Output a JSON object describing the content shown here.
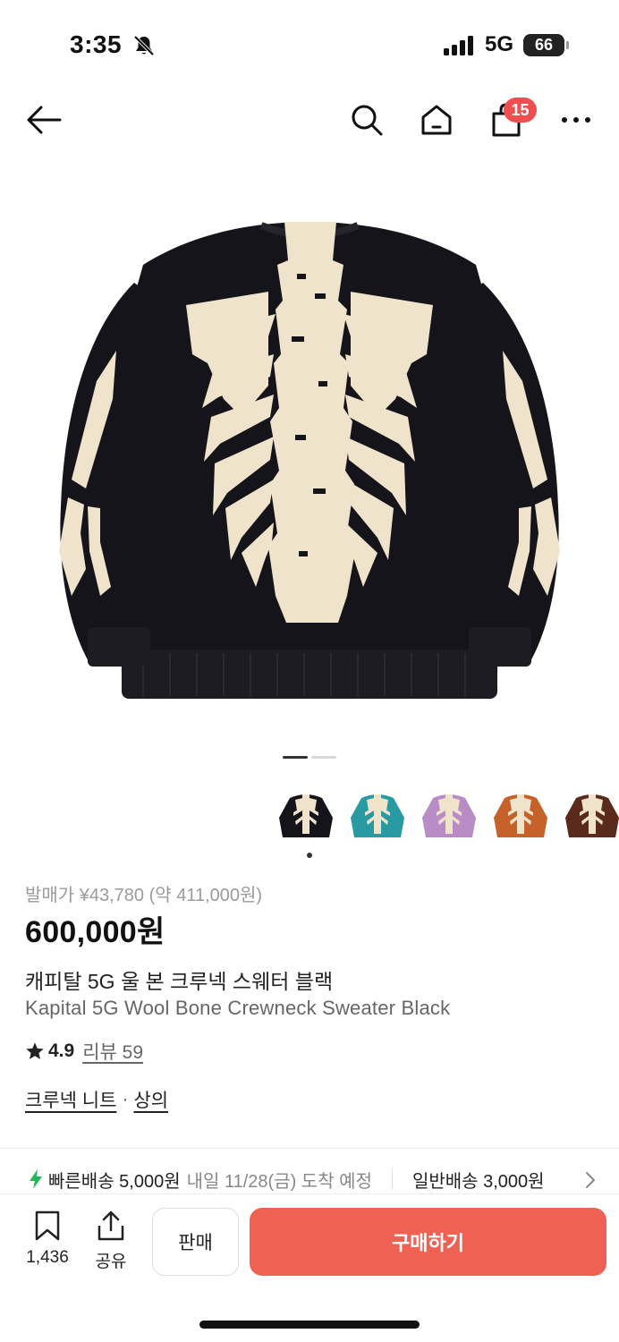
{
  "status_bar": {
    "time": "3:35",
    "network": "5G",
    "battery": "66"
  },
  "nav": {
    "cart_count": "15"
  },
  "gallery": {
    "page_count": 2,
    "current_page": 1,
    "colors": {
      "sweater": "#15141a",
      "bone": "#efe3cc"
    },
    "thumb_colors": [
      "#15141a",
      "#2a9aa2",
      "#b98cc6",
      "#c4622a",
      "#5a2a1c"
    ]
  },
  "product": {
    "release_price": "발매가 ¥43,780 (약 411,000원)",
    "price": "600,000원",
    "name_ko": "캐피탈 5G 울 본 크루넥 스웨터 블랙",
    "name_en": "Kapital 5G Wool Bone Crewneck Sweater Black",
    "rating": "4.9",
    "review_label": "리뷰 59",
    "category_1": "크루넥 니트",
    "category_sep": "·",
    "category_2": "상의"
  },
  "shipping": {
    "fast_label": "빠른배송 5,000원",
    "fast_eta": "내일 11/28(금) 도착 예정",
    "normal_label": "일반배송 3,000원"
  },
  "bottom_bar": {
    "save_count": "1,436",
    "share_label": "공유",
    "sell_label": "판매",
    "buy_label": "구매하기"
  },
  "accent": "#ef6253"
}
